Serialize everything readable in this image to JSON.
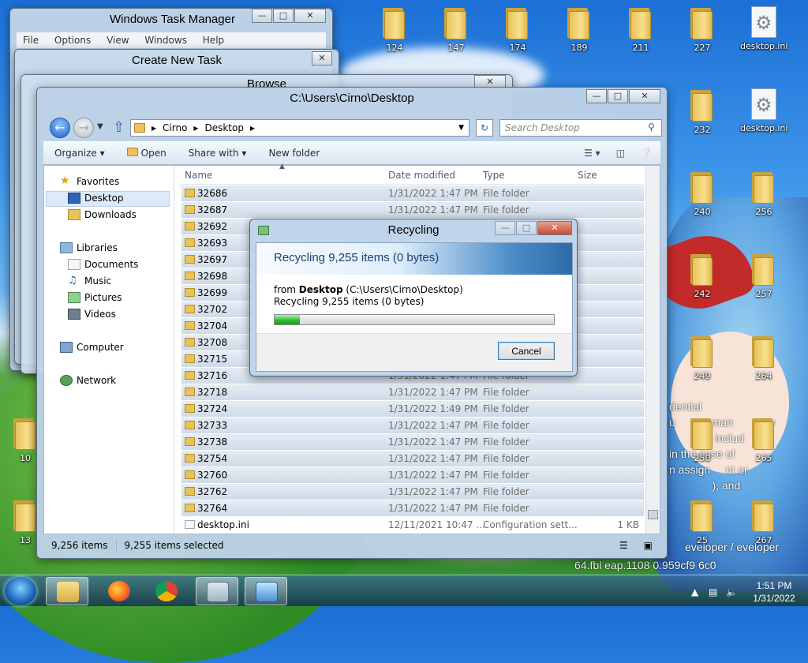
{
  "desktop": {
    "icons": [
      {
        "label": "124"
      },
      {
        "label": "147"
      },
      {
        "label": "174"
      },
      {
        "label": "189"
      },
      {
        "label": "211"
      },
      {
        "label": "227"
      },
      {
        "label": "desktop.ini"
      },
      {
        "label": "232"
      },
      {
        "label": "desktop.ini"
      },
      {
        "label": "240"
      },
      {
        "label": "256"
      },
      {
        "label": "242"
      },
      {
        "label": "257"
      },
      {
        "label": "249"
      },
      {
        "label": "264"
      },
      {
        "label": "250"
      },
      {
        "label": "265"
      },
      {
        "label": "25"
      },
      {
        "label": "267"
      },
      {
        "label": "10"
      },
      {
        "label": "13"
      }
    ],
    "overlay_lines": "dential\nu         y man          ay\n            d includ\nin the case of\nn assign     nt or\n              ), and",
    "overlay_bottom": "64.fbl    eap.1108      0.959cf9        6c0",
    "overlay_developer": "eveloper / eveloper"
  },
  "taskmgr": {
    "title": "Windows Task Manager",
    "menu": [
      "File",
      "Options",
      "View",
      "Windows",
      "Help"
    ]
  },
  "createtask": {
    "title": "Create New Task"
  },
  "browse": {
    "title": "Browse"
  },
  "explorer": {
    "title": "C:\\Users\\Cirno\\Desktop",
    "breadcrumb": [
      "Cirno",
      "Desktop"
    ],
    "search_placeholder": "Search Desktop",
    "toolbar": {
      "organize": "Organize",
      "open": "Open",
      "share": "Share with",
      "newfolder": "New folder"
    },
    "nav": {
      "favorites": "Favorites",
      "desktop": "Desktop",
      "downloads": "Downloads",
      "libraries": "Libraries",
      "documents": "Documents",
      "music": "Music",
      "pictures": "Pictures",
      "videos": "Videos",
      "computer": "Computer",
      "network": "Network"
    },
    "columns": {
      "name": "Name",
      "date": "Date modified",
      "type": "Type",
      "size": "Size"
    },
    "rows": [
      {
        "name": "32686",
        "date": "1/31/2022 1:47 PM",
        "type": "File folder",
        "size": ""
      },
      {
        "name": "32687",
        "date": "1/31/2022 1:47 PM",
        "type": "File folder",
        "size": ""
      },
      {
        "name": "32692",
        "date": "",
        "type": "",
        "size": ""
      },
      {
        "name": "32693",
        "date": "",
        "type": "",
        "size": ""
      },
      {
        "name": "32697",
        "date": "",
        "type": "",
        "size": ""
      },
      {
        "name": "32698",
        "date": "",
        "type": "",
        "size": ""
      },
      {
        "name": "32699",
        "date": "",
        "type": "",
        "size": ""
      },
      {
        "name": "32702",
        "date": "",
        "type": "",
        "size": ""
      },
      {
        "name": "32704",
        "date": "",
        "type": "",
        "size": ""
      },
      {
        "name": "32708",
        "date": "",
        "type": "",
        "size": ""
      },
      {
        "name": "32715",
        "date": "",
        "type": "",
        "size": ""
      },
      {
        "name": "32716",
        "date": "1/31/2022 1:47 PM",
        "type": "File folder",
        "size": ""
      },
      {
        "name": "32718",
        "date": "1/31/2022 1:47 PM",
        "type": "File folder",
        "size": ""
      },
      {
        "name": "32724",
        "date": "1/31/2022 1:49 PM",
        "type": "File folder",
        "size": ""
      },
      {
        "name": "32733",
        "date": "1/31/2022 1:47 PM",
        "type": "File folder",
        "size": ""
      },
      {
        "name": "32738",
        "date": "1/31/2022 1:47 PM",
        "type": "File folder",
        "size": ""
      },
      {
        "name": "32754",
        "date": "1/31/2022 1:47 PM",
        "type": "File folder",
        "size": ""
      },
      {
        "name": "32760",
        "date": "1/31/2022 1:47 PM",
        "type": "File folder",
        "size": ""
      },
      {
        "name": "32762",
        "date": "1/31/2022 1:47 PM",
        "type": "File folder",
        "size": ""
      },
      {
        "name": "32764",
        "date": "1/31/2022 1:47 PM",
        "type": "File folder",
        "size": ""
      },
      {
        "name": "desktop.ini",
        "date": "12/11/2021 10:47 ...",
        "type": "Configuration sett...",
        "size": "1 KB"
      }
    ],
    "status": {
      "items": "9,256 items",
      "selected": "9,255 items selected"
    }
  },
  "recycle": {
    "title": "Recycling",
    "heading": "Recycling 9,255 items (0 bytes)",
    "from_label": "from",
    "from_bold": "Desktop",
    "from_path": "(C:\\Users\\Cirno\\Desktop)",
    "detail": "Recycling 9,255 items (0 bytes)",
    "progress": 0.09,
    "cancel": "Cancel"
  },
  "taskbar": {
    "time": "1:51 PM",
    "date": "1/31/2022"
  },
  "colors": {
    "accent": "#1f62b8",
    "progress": "#2fbf2f"
  }
}
